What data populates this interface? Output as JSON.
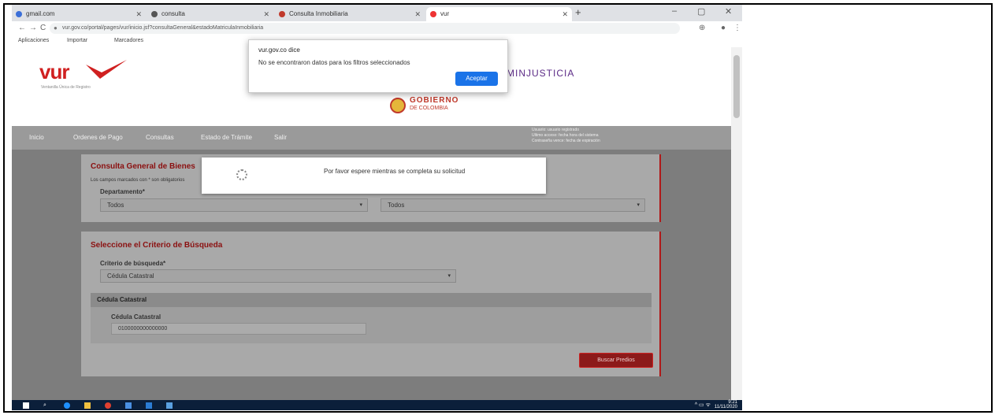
{
  "browser": {
    "tabs": [
      {
        "label": "gmail.com",
        "active": false
      },
      {
        "label": "consulta",
        "active": false
      },
      {
        "label": "Consulta Inmobiliaria",
        "active": false
      },
      {
        "label": "vur",
        "active": true
      }
    ],
    "new_tab": "+",
    "window_controls": [
      "–",
      "▢",
      "✕"
    ],
    "nav": {
      "back": "←",
      "forward": "→",
      "reload": "C"
    },
    "url": "vur.gov.co/portal/pages/vur/inicio.jsf?consultaGeneral&estadoMatriculaInmobiliaria",
    "menu": "⋮",
    "bookmarks": [
      "Aplicaciones",
      "Importar",
      "Marcadores"
    ]
  },
  "header": {
    "logo_text": "vur",
    "logo_sub": "Ventanilla Única de Registro",
    "ministry": "MINJUSTICIA",
    "gov_line1": "GOBIERNO",
    "gov_line2": "DE COLOMBIA"
  },
  "menubar": {
    "items": [
      "Inicio",
      "Ordenes de Pago",
      "Consultas",
      "Estado de Trámite",
      "Salir"
    ],
    "user_line1": "Usuario: usuario registrado",
    "user_line2": "Ultimo acceso: fecha hora del sistema",
    "user_line3": "Contraseña vence: fecha de expiración"
  },
  "panel1": {
    "title": "Consulta General de Bienes",
    "hint": "Los campos marcados con * son obligatorios",
    "department_label": "Departamento*",
    "department_value": "Todos",
    "city_value": "Todos"
  },
  "panel2": {
    "title": "Seleccione el Criterio de Búsqueda",
    "criteria_label": "Criterio de búsqueda*",
    "criteria_value": "Cédula Catastral",
    "subpanel_title": "Cédula Catastral",
    "field_label": "Cédula Catastral",
    "field_value": "0100000000000000",
    "search_button": "Buscar Predios"
  },
  "loading": {
    "message": "Por favor espere mientras se completa su solicitud"
  },
  "alert": {
    "title": "vur.gov.co dice",
    "message": "No se encontraron datos para los filtros seleccionados",
    "ok": "Aceptar"
  },
  "taskbar": {
    "time": "9:21",
    "date": "11/11/2020",
    "tray": "^ ▭ ᯤ"
  },
  "colors": {
    "accent_red": "#b01818",
    "ministry_purple": "#5b2a86",
    "dialog_button": "#1a73e8",
    "taskbar": "#0b1f3a"
  }
}
